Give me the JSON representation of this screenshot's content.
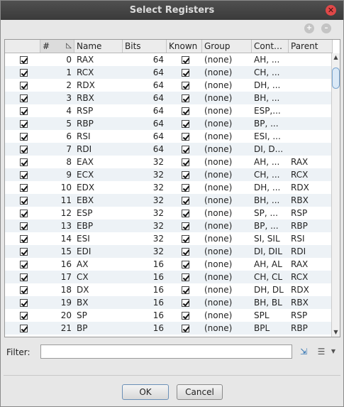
{
  "window": {
    "title": "Select Registers"
  },
  "columns": [
    "#",
    "Name",
    "Bits",
    "Known",
    "Group",
    "Cont…",
    "Parent"
  ],
  "rows": [
    {
      "n": "0",
      "name": "RAX",
      "bits": "64",
      "group": "(none)",
      "cont": "AH, ...",
      "parent": ""
    },
    {
      "n": "1",
      "name": "RCX",
      "bits": "64",
      "group": "(none)",
      "cont": "CH, ...",
      "parent": ""
    },
    {
      "n": "2",
      "name": "RDX",
      "bits": "64",
      "group": "(none)",
      "cont": "DH, ...",
      "parent": ""
    },
    {
      "n": "3",
      "name": "RBX",
      "bits": "64",
      "group": "(none)",
      "cont": "BH, ...",
      "parent": ""
    },
    {
      "n": "4",
      "name": "RSP",
      "bits": "64",
      "group": "(none)",
      "cont": "ESP,...",
      "parent": ""
    },
    {
      "n": "5",
      "name": "RBP",
      "bits": "64",
      "group": "(none)",
      "cont": "BP, ...",
      "parent": ""
    },
    {
      "n": "6",
      "name": "RSI",
      "bits": "64",
      "group": "(none)",
      "cont": "ESI, ...",
      "parent": ""
    },
    {
      "n": "7",
      "name": "RDI",
      "bits": "64",
      "group": "(none)",
      "cont": "DI, D...",
      "parent": ""
    },
    {
      "n": "8",
      "name": "EAX",
      "bits": "32",
      "group": "(none)",
      "cont": "AH, ...",
      "parent": "RAX"
    },
    {
      "n": "9",
      "name": "ECX",
      "bits": "32",
      "group": "(none)",
      "cont": "CH, ...",
      "parent": "RCX"
    },
    {
      "n": "10",
      "name": "EDX",
      "bits": "32",
      "group": "(none)",
      "cont": "DH, ...",
      "parent": "RDX"
    },
    {
      "n": "11",
      "name": "EBX",
      "bits": "32",
      "group": "(none)",
      "cont": "BH, ...",
      "parent": "RBX"
    },
    {
      "n": "12",
      "name": "ESP",
      "bits": "32",
      "group": "(none)",
      "cont": "SP, ...",
      "parent": "RSP"
    },
    {
      "n": "13",
      "name": "EBP",
      "bits": "32",
      "group": "(none)",
      "cont": "BP, ...",
      "parent": "RBP"
    },
    {
      "n": "14",
      "name": "ESI",
      "bits": "32",
      "group": "(none)",
      "cont": "SI, SIL",
      "parent": "RSI"
    },
    {
      "n": "15",
      "name": "EDI",
      "bits": "32",
      "group": "(none)",
      "cont": "DI, DIL",
      "parent": "RDI"
    },
    {
      "n": "16",
      "name": "AX",
      "bits": "16",
      "group": "(none)",
      "cont": "AH, AL",
      "parent": "RAX"
    },
    {
      "n": "17",
      "name": "CX",
      "bits": "16",
      "group": "(none)",
      "cont": "CH, CL",
      "parent": "RCX"
    },
    {
      "n": "18",
      "name": "DX",
      "bits": "16",
      "group": "(none)",
      "cont": "DH, DL",
      "parent": "RDX"
    },
    {
      "n": "19",
      "name": "BX",
      "bits": "16",
      "group": "(none)",
      "cont": "BH, BL",
      "parent": "RBX"
    },
    {
      "n": "20",
      "name": "SP",
      "bits": "16",
      "group": "(none)",
      "cont": "SPL",
      "parent": "RSP"
    },
    {
      "n": "21",
      "name": "BP",
      "bits": "16",
      "group": "(none)",
      "cont": "BPL",
      "parent": "RBP"
    }
  ],
  "filter": {
    "label": "Filter:",
    "value": ""
  },
  "buttons": {
    "ok": "OK",
    "cancel": "Cancel"
  },
  "icons": {
    "close": "close-icon",
    "sort": "sort-icon",
    "filter_options": "filter-options-icon"
  },
  "colors": {
    "titlebar": "#444444",
    "close": "#e04848",
    "alt_row": "#edf2f6"
  }
}
